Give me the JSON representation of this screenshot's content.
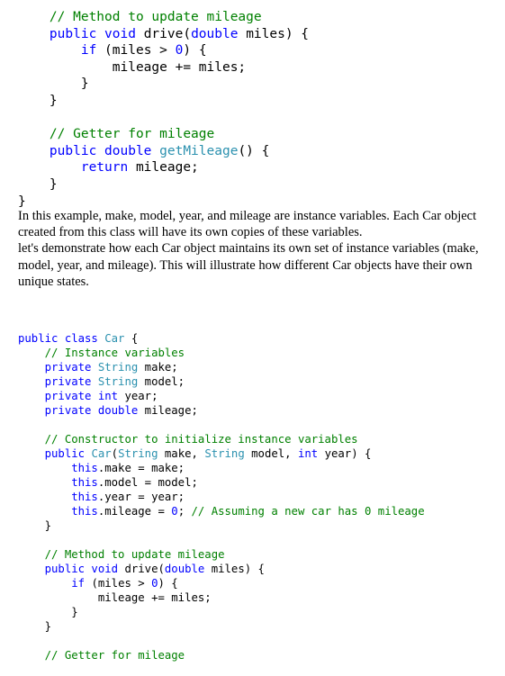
{
  "code_top": [
    [
      {
        "c": "cm",
        "t": "    // Method to update mileage"
      }
    ],
    [
      {
        "c": "kw",
        "t": "    public void "
      },
      {
        "c": "tx",
        "t": "drive("
      },
      {
        "c": "kw",
        "t": "double"
      },
      {
        "c": "tx",
        "t": " miles) {"
      }
    ],
    [
      {
        "c": "kw",
        "t": "        if"
      },
      {
        "c": "tx",
        "t": " (miles > "
      },
      {
        "c": "kw",
        "t": "0"
      },
      {
        "c": "tx",
        "t": ") {"
      }
    ],
    [
      {
        "c": "tx",
        "t": "            mileage += miles;"
      }
    ],
    [
      {
        "c": "tx",
        "t": "        }"
      }
    ],
    [
      {
        "c": "tx",
        "t": "    }"
      }
    ],
    [
      {
        "c": "tx",
        "t": ""
      }
    ],
    [
      {
        "c": "cm",
        "t": "    // Getter for mileage"
      }
    ],
    [
      {
        "c": "kw",
        "t": "    public double "
      },
      {
        "c": "ty",
        "t": "getMileage"
      },
      {
        "c": "tx",
        "t": "() {"
      }
    ],
    [
      {
        "c": "kw",
        "t": "        return"
      },
      {
        "c": "tx",
        "t": " mileage;"
      }
    ],
    [
      {
        "c": "tx",
        "t": "    }"
      }
    ],
    [
      {
        "c": "tx",
        "t": "}"
      }
    ]
  ],
  "prose": {
    "p1": "In this example, make, model, year, and mileage are instance variables. Each Car object created from this class will have its own copies of these variables.",
    "p2": "let's demonstrate how each Car object maintains its own set of instance variables (make, model, year, and mileage). This will illustrate how different Car objects have their own unique states."
  },
  "code_bottom": [
    [
      {
        "c": "kw",
        "t": "public class "
      },
      {
        "c": "ty",
        "t": "Car"
      },
      {
        "c": "tx",
        "t": " {"
      }
    ],
    [
      {
        "c": "cm",
        "t": "    // Instance variables"
      }
    ],
    [
      {
        "c": "kw",
        "t": "    private "
      },
      {
        "c": "ty",
        "t": "String"
      },
      {
        "c": "tx",
        "t": " make;"
      }
    ],
    [
      {
        "c": "kw",
        "t": "    private "
      },
      {
        "c": "ty",
        "t": "String"
      },
      {
        "c": "tx",
        "t": " model;"
      }
    ],
    [
      {
        "c": "kw",
        "t": "    private int"
      },
      {
        "c": "tx",
        "t": " year;"
      }
    ],
    [
      {
        "c": "kw",
        "t": "    private double"
      },
      {
        "c": "tx",
        "t": " mileage;"
      }
    ],
    [
      {
        "c": "tx",
        "t": ""
      }
    ],
    [
      {
        "c": "cm",
        "t": "    // Constructor to initialize instance variables"
      }
    ],
    [
      {
        "c": "kw",
        "t": "    public "
      },
      {
        "c": "ty",
        "t": "Car"
      },
      {
        "c": "tx",
        "t": "("
      },
      {
        "c": "ty",
        "t": "String"
      },
      {
        "c": "tx",
        "t": " make, "
      },
      {
        "c": "ty",
        "t": "String"
      },
      {
        "c": "tx",
        "t": " model, "
      },
      {
        "c": "kw",
        "t": "int"
      },
      {
        "c": "tx",
        "t": " year) {"
      }
    ],
    [
      {
        "c": "kw",
        "t": "        this"
      },
      {
        "c": "tx",
        "t": ".make = make;"
      }
    ],
    [
      {
        "c": "kw",
        "t": "        this"
      },
      {
        "c": "tx",
        "t": ".model = model;"
      }
    ],
    [
      {
        "c": "kw",
        "t": "        this"
      },
      {
        "c": "tx",
        "t": ".year = year;"
      }
    ],
    [
      {
        "c": "kw",
        "t": "        this"
      },
      {
        "c": "tx",
        "t": ".mileage = "
      },
      {
        "c": "kw",
        "t": "0"
      },
      {
        "c": "tx",
        "t": "; "
      },
      {
        "c": "cm",
        "t": "// Assuming a new car has 0 mileage"
      }
    ],
    [
      {
        "c": "tx",
        "t": "    }"
      }
    ],
    [
      {
        "c": "tx",
        "t": ""
      }
    ],
    [
      {
        "c": "cm",
        "t": "    // Method to update mileage"
      }
    ],
    [
      {
        "c": "kw",
        "t": "    public void "
      },
      {
        "c": "tx",
        "t": "drive("
      },
      {
        "c": "kw",
        "t": "double"
      },
      {
        "c": "tx",
        "t": " miles) {"
      }
    ],
    [
      {
        "c": "kw",
        "t": "        if"
      },
      {
        "c": "tx",
        "t": " (miles > "
      },
      {
        "c": "kw",
        "t": "0"
      },
      {
        "c": "tx",
        "t": ") {"
      }
    ],
    [
      {
        "c": "tx",
        "t": "            mileage += miles;"
      }
    ],
    [
      {
        "c": "tx",
        "t": "        }"
      }
    ],
    [
      {
        "c": "tx",
        "t": "    }"
      }
    ],
    [
      {
        "c": "tx",
        "t": ""
      }
    ],
    [
      {
        "c": "cm",
        "t": "    // Getter for mileage"
      }
    ]
  ]
}
